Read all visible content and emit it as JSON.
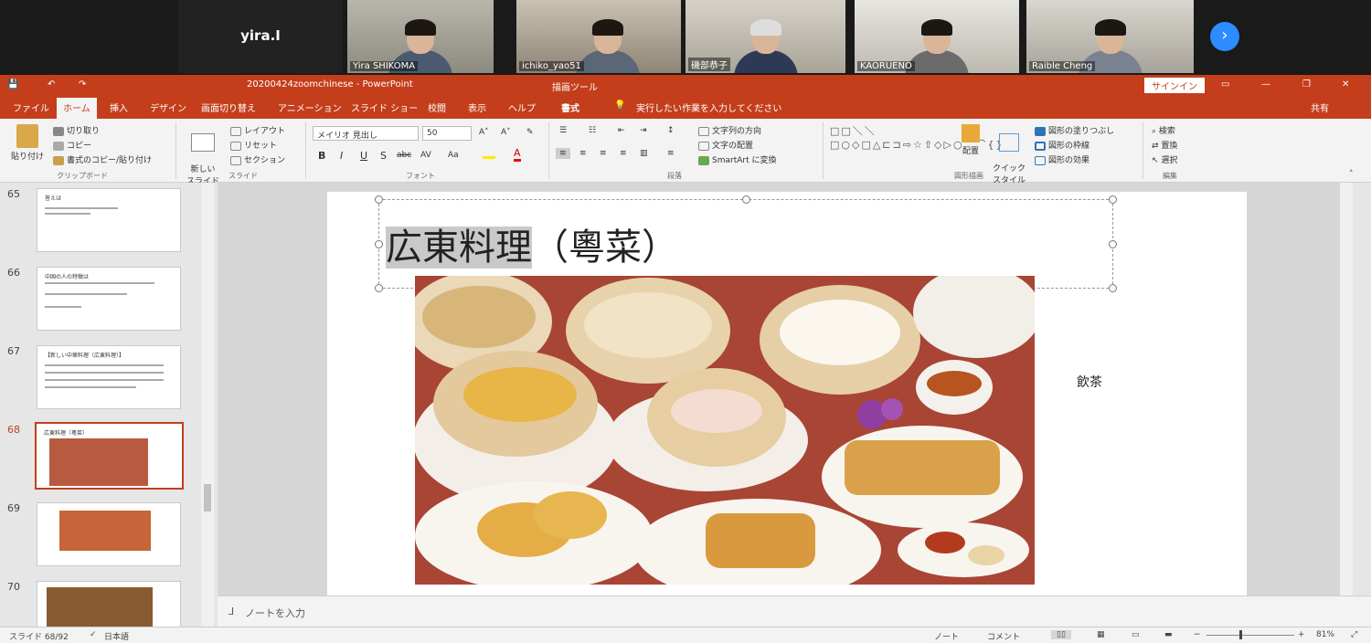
{
  "zoom": {
    "participants": [
      {
        "name": "yira.I"
      },
      {
        "name": "Yira SHIKOMA"
      },
      {
        "name": "ichiko_yao51"
      },
      {
        "name": "磯部恭子"
      },
      {
        "name": "KAORUENO"
      },
      {
        "name": "Raible Cheng"
      }
    ],
    "next_icon": "›"
  },
  "window": {
    "title": "20200424zoomchinese - PowerPoint",
    "tool_tab": "描画ツール",
    "signin": "サインイン",
    "share": "共有"
  },
  "tabs": [
    "ファイル",
    "ホーム",
    "挿入",
    "デザイン",
    "画面切り替え",
    "アニメーション",
    "スライド ショー",
    "校閲",
    "表示",
    "ヘルプ",
    "書式"
  ],
  "tell_me": "実行したい作業を入力してください",
  "ribbon": {
    "paste": "貼り付け",
    "cut": "切り取り",
    "copy": "コピー",
    "format_painter": "書式のコピー/貼り付け",
    "clipboard_label": "クリップボード",
    "new_slide": "新しい\nスライド",
    "layout": "レイアウト",
    "reset": "リセット",
    "section": "セクション",
    "slides_label": "スライド",
    "font_name": "メイリオ 見出し",
    "font_size": "50",
    "font_label": "フォント",
    "text_direction": "文字列の方向",
    "align_text": "文字の配置",
    "smartart": "SmartArt に変換",
    "paragraph_label": "段落",
    "arrange": "配置",
    "quick_styles": "クイック\nスタイル",
    "shape_fill": "図形の塗りつぶし",
    "shape_outline": "図形の枠線",
    "shape_effects": "図形の効果",
    "drawing_label": "図形描画",
    "find": "検索",
    "replace": "置換",
    "select": "選択",
    "editing_label": "編集"
  },
  "thumbs": [
    {
      "num": "65",
      "title": "答えは"
    },
    {
      "num": "66",
      "title": "中国の人の特徴は"
    },
    {
      "num": "67",
      "title": "【新しい中華料理（広東料理）】"
    },
    {
      "num": "68",
      "title": "広東料理（粵菜）"
    },
    {
      "num": "69",
      "title": ""
    },
    {
      "num": "70",
      "title": ""
    }
  ],
  "slide": {
    "title_highlight": "広東料理",
    "title_rest": "（粵菜）",
    "side_text": "飲茶"
  },
  "notes_placeholder": "ノートを入力",
  "status": {
    "slide_count": "スライド 68/92",
    "language": "日本語",
    "notes": "ノート",
    "comments": "コメント",
    "zoom": "81%"
  }
}
